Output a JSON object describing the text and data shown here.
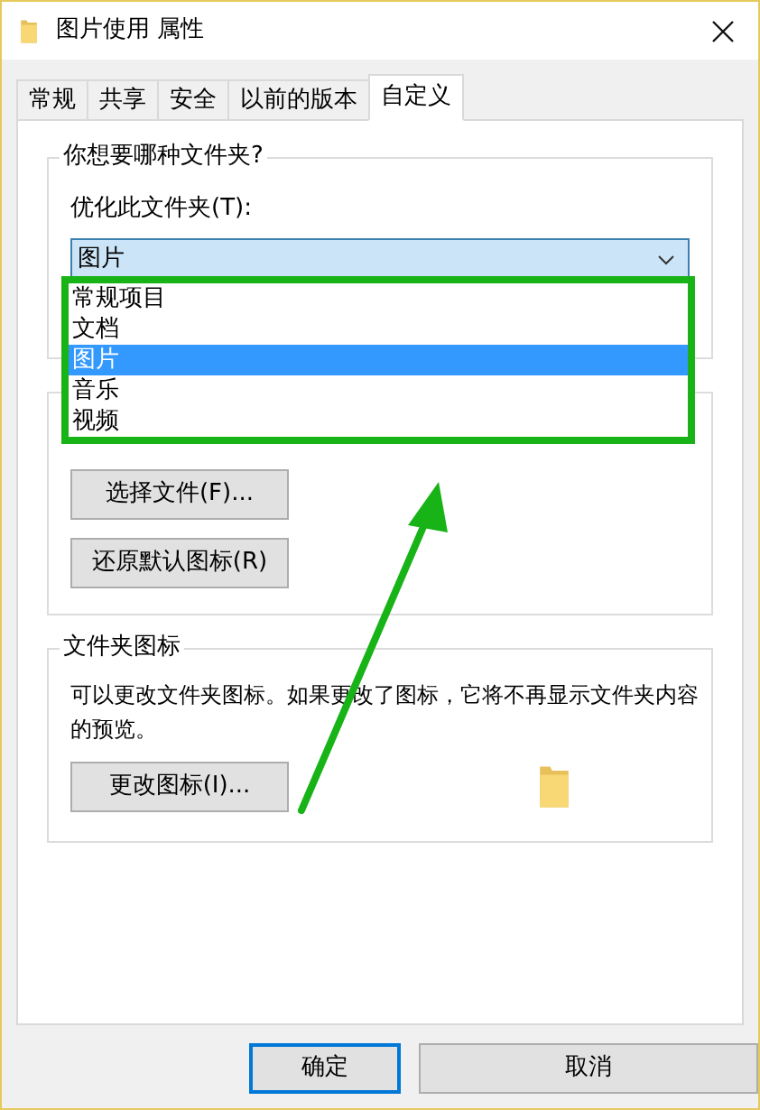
{
  "window": {
    "title": "图片使用 属性"
  },
  "tabs": [
    {
      "label": "常规",
      "selected": false
    },
    {
      "label": "共享",
      "selected": false
    },
    {
      "label": "安全",
      "selected": false
    },
    {
      "label": "以前的版本",
      "selected": false
    },
    {
      "label": "自定义",
      "selected": true
    }
  ],
  "folder_type_group": {
    "title": "你想要哪种文件夹?",
    "label": "优化此文件夹(T):",
    "dropdown": {
      "value": "图片",
      "expanded": true,
      "options": [
        {
          "label": "常规项目",
          "selected": false
        },
        {
          "label": "文档",
          "selected": false
        },
        {
          "label": "图片",
          "selected": true
        },
        {
          "label": "音乐",
          "selected": false
        },
        {
          "label": "视频",
          "selected": false
        }
      ]
    }
  },
  "folder_picture_group": {
    "buttons": [
      "选择文件(F)...",
      "还原默认图标(R)"
    ]
  },
  "folder_icon_group": {
    "title": "文件夹图标",
    "text": "可以更改文件夹图标。如果更改了图标，它将不再显示文件夹内容的预览。",
    "button": "更改图标(I)..."
  },
  "buttons": [
    {
      "label": "确定",
      "default": true
    },
    {
      "label": "取消",
      "default": false
    }
  ]
}
